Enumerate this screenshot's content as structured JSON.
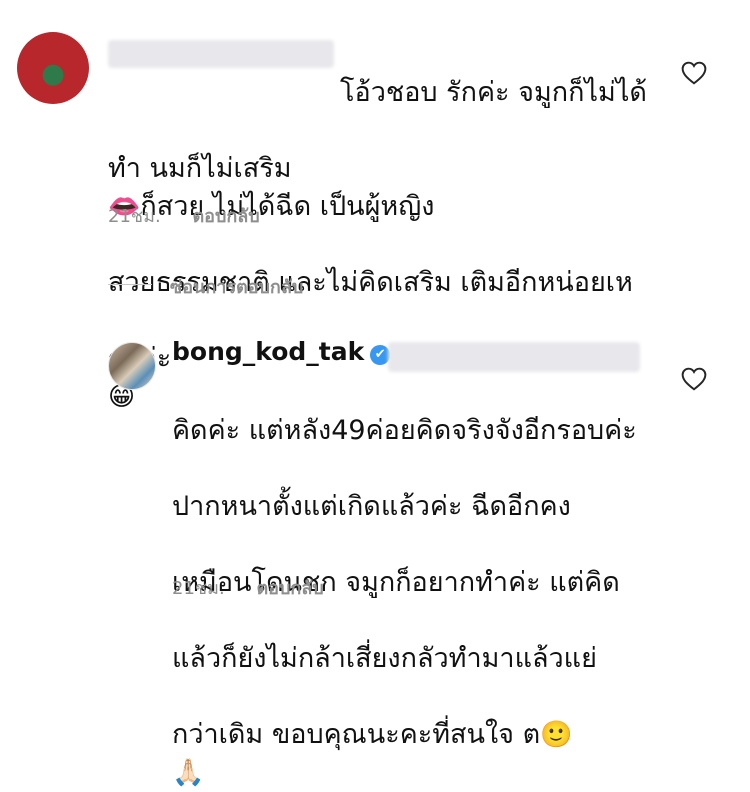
{
  "comment": {
    "line1": "โอ้วชอบ รักค่ะ จมูกก็ไม่ได้",
    "line2": "ทำ นมก็ไม่เสริม",
    "emoji_lips": "👄",
    "line2b": "ก็สวย ไม่ได้ฉีด เป็นผู้หญิง",
    "line3": "สวยธรรมชาติ และไม่คิดเสริม เติมอีกหน่อยเห",
    "line4": "รอค่ะ",
    "emoji_grin": "😁",
    "time": "21ชม.",
    "reply_label": "ตอบกลับ"
  },
  "hide_replies": "ซ่อนการตอบกลับ",
  "reply": {
    "username": "bong_kod_tak",
    "verified_glyph": "✔",
    "line1": "คิดค่ะ แต่หลัง49ค่อยคิดจริงจังอีกรอบค่ะ",
    "line2": "ปากหนาตั้งแต่เกิดแล้วค่ะ ฉีดอีกคง",
    "line3": "เหมือนโดนชก จมูกก็อยากทำค่ะ แต่คิด",
    "line4": "แล้วก็ยังไม่กล้าเสี่ยงกลัวทำมาแล้วแย่",
    "line5": "กว่าเดิม ขอบคุณนะคะที่สนใจ ต",
    "emoji_smile": "🙂",
    "emoji_pray": "🙏🏻",
    "time": "21ชม.",
    "reply_label": "ตอบกลับ"
  }
}
